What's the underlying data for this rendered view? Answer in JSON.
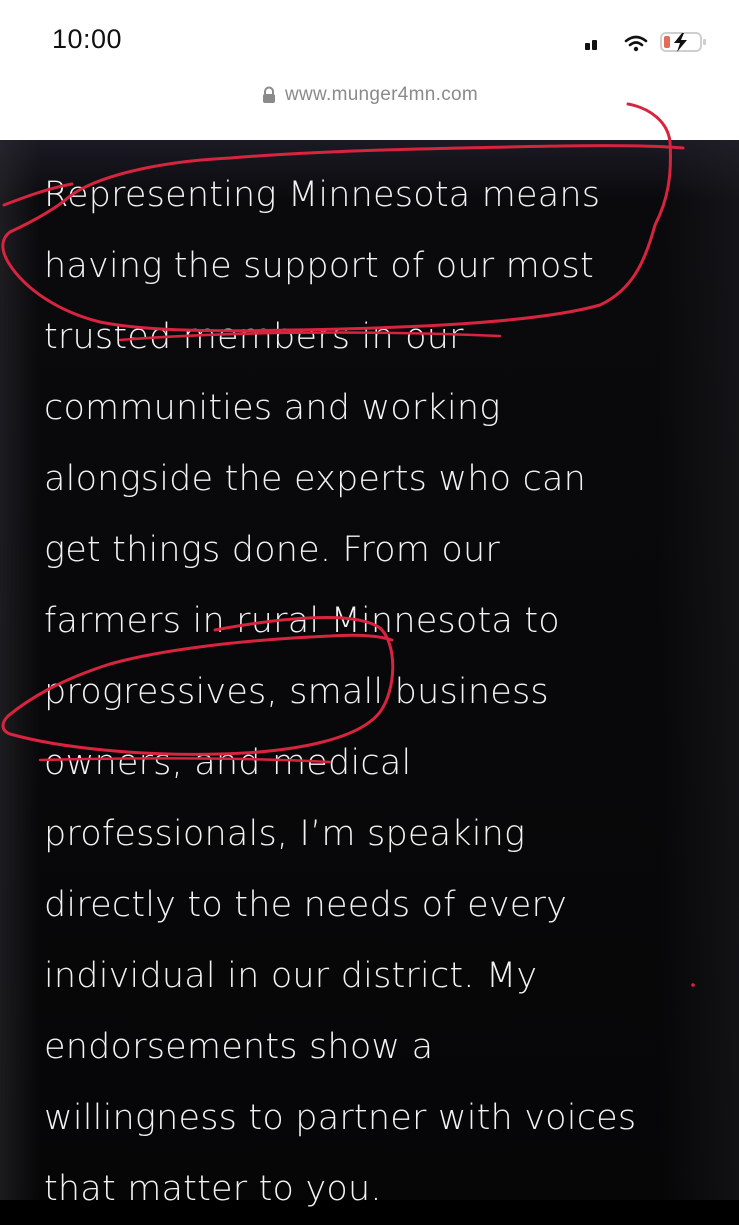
{
  "status_bar": {
    "time": "10:00",
    "icons": [
      "signal-icon",
      "wifi-icon",
      "battery-charging-icon"
    ],
    "battery_color": "#e46a5a"
  },
  "browser": {
    "url": "www.munger4mn.com",
    "lock_icon": "lock-icon"
  },
  "article": {
    "lines": [
      "Representing Minnesota means",
      "having the support of our most",
      "trusted members in our",
      "communities and working",
      "alongside the experts who can",
      "get things done. From our",
      "farmers in rural Minnesota to",
      "progressives, small business",
      "owners, and medical",
      "professionals, I’m speaking",
      "directly to the needs of every",
      "individual in our district. My",
      "endorsements show a",
      "willingness to partner with voices",
      "that matter to you."
    ]
  },
  "annotations": {
    "color": "#d8243f",
    "marks": [
      "circle-around-first-lines",
      "circle-around-progressives"
    ]
  }
}
